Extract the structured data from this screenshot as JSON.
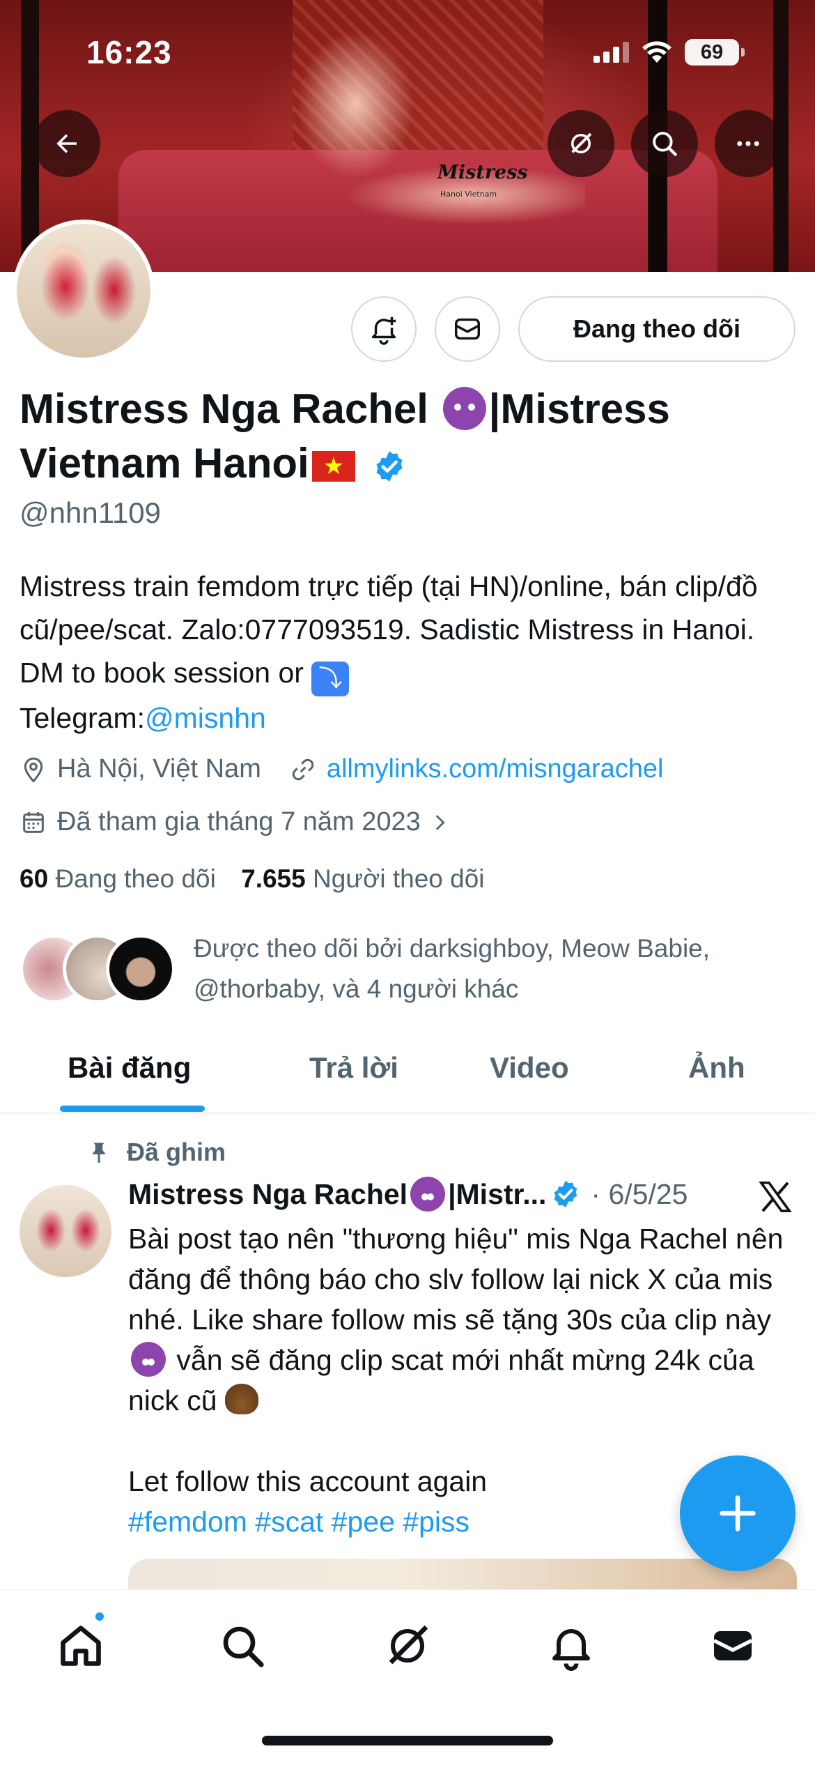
{
  "status_bar": {
    "time": "16:23",
    "battery": "69"
  },
  "profile": {
    "display_name_part1": "Mistress Nga Rachel",
    "display_name_part2": "|Mistress Vietnam Hanoi",
    "handle": "@nhn1109",
    "follow_button_label": "Đang theo dõi",
    "bio_line1": "Mistress train femdom trực tiếp (tại HN)/online, bán clip/đồ cũ/pee/scat. Zalo:0777093519. Sadistic Mistress in Hanoi. DM to book session or ",
    "bio_arrow": "⤵",
    "bio_line2": "Telegram:",
    "bio_link": "@misnhn",
    "location": "Hà Nội, Việt Nam",
    "website": "allmylinks.com/misngarachel",
    "joined": "Đã tham gia tháng 7 năm 2023",
    "following_count": "60",
    "following_label": "Đang theo dõi",
    "followers_count": "7.655",
    "followers_label": "Người theo dõi",
    "followed_by": "Được theo dõi bởi darksighboy, Meow Babie, @thorbaby, và 4 người khác"
  },
  "banner_watermark": {
    "brand": "Mistress",
    "place": "Hanoi Vietnam"
  },
  "tabs": [
    {
      "label": "Bài đăng",
      "active": true
    },
    {
      "label": "Trả lời",
      "active": false
    },
    {
      "label": "Video",
      "active": false
    },
    {
      "label": "Ảnh",
      "active": false
    }
  ],
  "pinned_post": {
    "pinned_label": "Đã ghim",
    "author": "Mistress Nga Rachel",
    "author_suffix": "|Mistr...",
    "date": "· 6/5/25",
    "text1": "Bài post tạo nên \"thương hiệu\" mis Nga Rachel nên đăng để thông báo cho slv follow lại nick X của mis nhé. Like share follow mis sẽ tặng 30s của clip này",
    "text2": " vẫn sẽ đăng clip scat mới nhất mừng 24k của nick cũ",
    "text3": "Let follow this account again",
    "hashtags": "#femdom #scat #pee #piss"
  },
  "colors": {
    "accent": "#1d9bf0",
    "text": "#0f1419",
    "secondary": "#536471",
    "border": "#cfd9de"
  },
  "icons": [
    "back-arrow-icon",
    "grok-icon",
    "search-icon",
    "more-icon",
    "notification-bell-plus-icon",
    "message-icon",
    "verified-badge-icon",
    "location-icon",
    "link-icon",
    "calendar-icon",
    "chevron-right-icon",
    "pin-icon",
    "x-logo-icon",
    "compose-plus-icon",
    "home-icon",
    "notifications-icon",
    "messages-icon"
  ]
}
